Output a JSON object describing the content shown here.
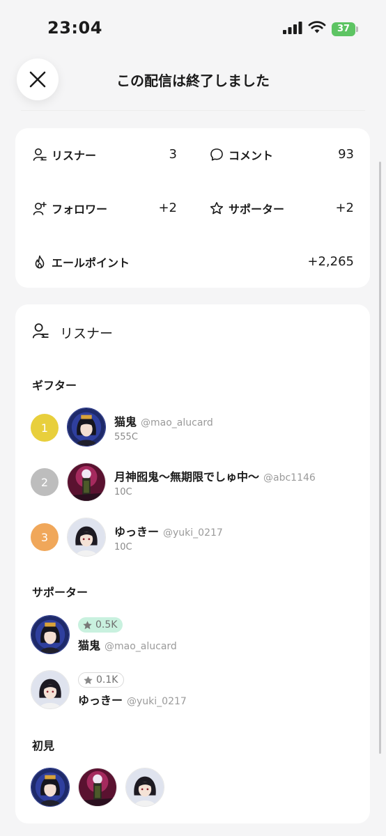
{
  "status_bar": {
    "time": "23:04",
    "battery": "37"
  },
  "header": {
    "title": "この配信は終了しました"
  },
  "stats": {
    "listeners": {
      "label": "リスナー",
      "value": "3"
    },
    "comments": {
      "label": "コメント",
      "value": "93"
    },
    "followers": {
      "label": "フォロワー",
      "value": "+2"
    },
    "supporters": {
      "label": "サポーター",
      "value": "+2"
    },
    "cheer_points": {
      "label": "エールポイント",
      "value": "+2,265"
    }
  },
  "listeners_section": {
    "title": "リスナー",
    "gifters_title": "ギフター",
    "gifters": [
      {
        "rank": "1",
        "name": "猫鬼",
        "handle": "@mao_alucard",
        "coins": "555C"
      },
      {
        "rank": "2",
        "name": "月神囮鬼〜無期限でしゅ中〜",
        "handle": "@abc1146",
        "coins": "10C"
      },
      {
        "rank": "3",
        "name": "ゆっきー",
        "handle": "@yuki_0217",
        "coins": "10C"
      }
    ],
    "supporters_title": "サポーター",
    "supporters": [
      {
        "badge": "0.5K",
        "name": "猫鬼",
        "handle": "@mao_alucard"
      },
      {
        "badge": "0.1K",
        "name": "ゆっきー",
        "handle": "@yuki_0217"
      }
    ],
    "first_time_title": "初見"
  },
  "colors": {
    "rank1": "#e8cf3c",
    "rank2": "#bdbdbd",
    "rank3": "#f0a75a",
    "badge_green": "#c9f1df",
    "battery": "#5dc463"
  },
  "icons": [
    "close-icon",
    "listener-icon",
    "comment-icon",
    "follow-icon",
    "star-icon",
    "flame-icon"
  ]
}
